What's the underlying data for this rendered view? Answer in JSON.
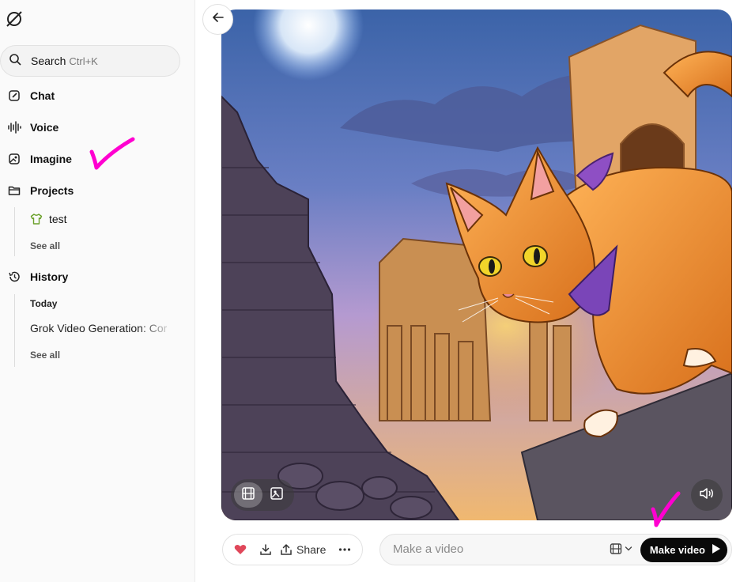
{
  "sidebar": {
    "search": {
      "label": "Search",
      "shortcut": "Ctrl+K"
    },
    "nav": {
      "chat": "Chat",
      "voice": "Voice",
      "imagine": "Imagine",
      "projects": "Projects",
      "history": "History"
    },
    "projects": {
      "items": [
        "test"
      ],
      "see_all": "See all"
    },
    "history": {
      "group": "Today",
      "items": [
        "Grok Video Generation: Cor"
      ],
      "see_all": "See all"
    }
  },
  "main": {
    "actions": {
      "share": "Share"
    },
    "prompt": {
      "placeholder": "Make a video",
      "value": ""
    },
    "make_video": "Make video"
  },
  "colors": {
    "annotation": "#ff00d0",
    "heart": "#e0475a",
    "button_dark": "#0a0a0a"
  },
  "icons": [
    "grok-logo-icon",
    "search-icon",
    "chat-pen-icon",
    "voice-wave-icon",
    "imagine-icon",
    "folder-icon",
    "shirt-icon",
    "history-icon",
    "back-arrow-icon",
    "film-icon",
    "image-icon",
    "speaker-icon",
    "heart-icon",
    "download-icon",
    "share-icon",
    "more-icon",
    "video-mode-icon",
    "chevron-down-icon",
    "play-icon",
    "checkmark-annotation"
  ]
}
